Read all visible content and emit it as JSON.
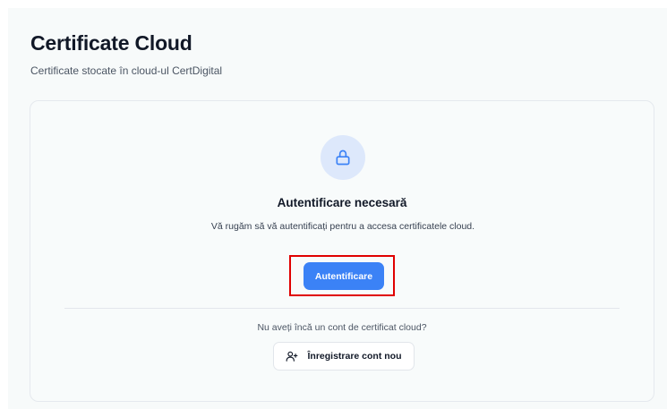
{
  "header": {
    "title": "Certificate Cloud",
    "subtitle": "Certificate stocate în cloud-ul CertDigital"
  },
  "auth_card": {
    "icon": "lock-icon",
    "title": "Autentificare necesară",
    "description": "Vă rugăm să vă autentificați pentru a accesa certificatele cloud.",
    "login_button": "Autentificare",
    "no_account_text": "Nu aveți încă un cont de certificat cloud?",
    "register_icon": "user-plus-icon",
    "register_button": "Înregistrare cont nou"
  },
  "colors": {
    "primary": "#3b82f6",
    "highlight_border": "#e00000",
    "lock_circle_bg": "#dde8fb"
  }
}
